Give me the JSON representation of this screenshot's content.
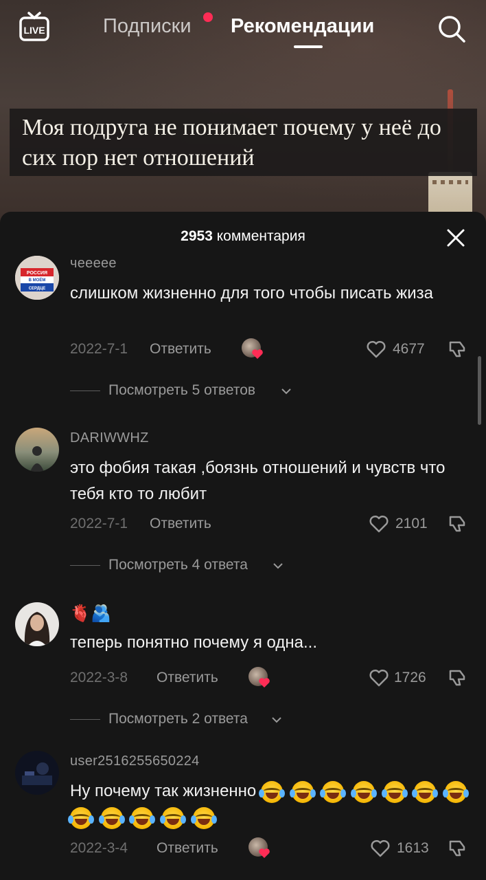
{
  "topbar": {
    "live_label": "LIVE",
    "tab_subscriptions": "Подписки",
    "tab_recommendations": "Рекомендации"
  },
  "video": {
    "caption": "Моя подруга не понимает почему у неё до сих пор нет отношений"
  },
  "comments_sheet": {
    "count": "2953",
    "count_label": "комментария"
  },
  "comments": [
    {
      "username": "чеееее",
      "avatar_text": "РОССИЯ В МОЁМ СЕРДЦЕ",
      "text": "слишком жизненно для того чтобы писать жиза",
      "date": "2022-7-1",
      "reply_label": "Ответить",
      "likes": "4677",
      "author_liked": true,
      "view_replies": "Посмотреть 5 ответов"
    },
    {
      "username": "DARIWWHZ",
      "text": "это фобия такая ,боязнь отношений и чувств что тебя кто то любит",
      "date": "2022-7-1",
      "reply_label": "Ответить",
      "likes": "2101",
      "author_liked": false,
      "view_replies": "Посмотреть 4 ответа"
    },
    {
      "username": "🫀🫂",
      "text": "теперь понятно почему я одна...",
      "date": "2022-3-8",
      "reply_label": "Ответить",
      "likes": "1726",
      "author_liked": true,
      "view_replies": "Посмотреть 2 ответа"
    },
    {
      "username": "user2516255650224",
      "text": "Ну почему так жизненно",
      "emoji_count": 12,
      "emoji": "laughing-with-tears",
      "date": "2022-3-4",
      "reply_label": "Ответить",
      "likes": "1613",
      "author_liked": true
    }
  ],
  "colors": {
    "accent": "#fe2c55",
    "sheet_bg": "#161616",
    "muted_text": "#9a9a9a"
  }
}
